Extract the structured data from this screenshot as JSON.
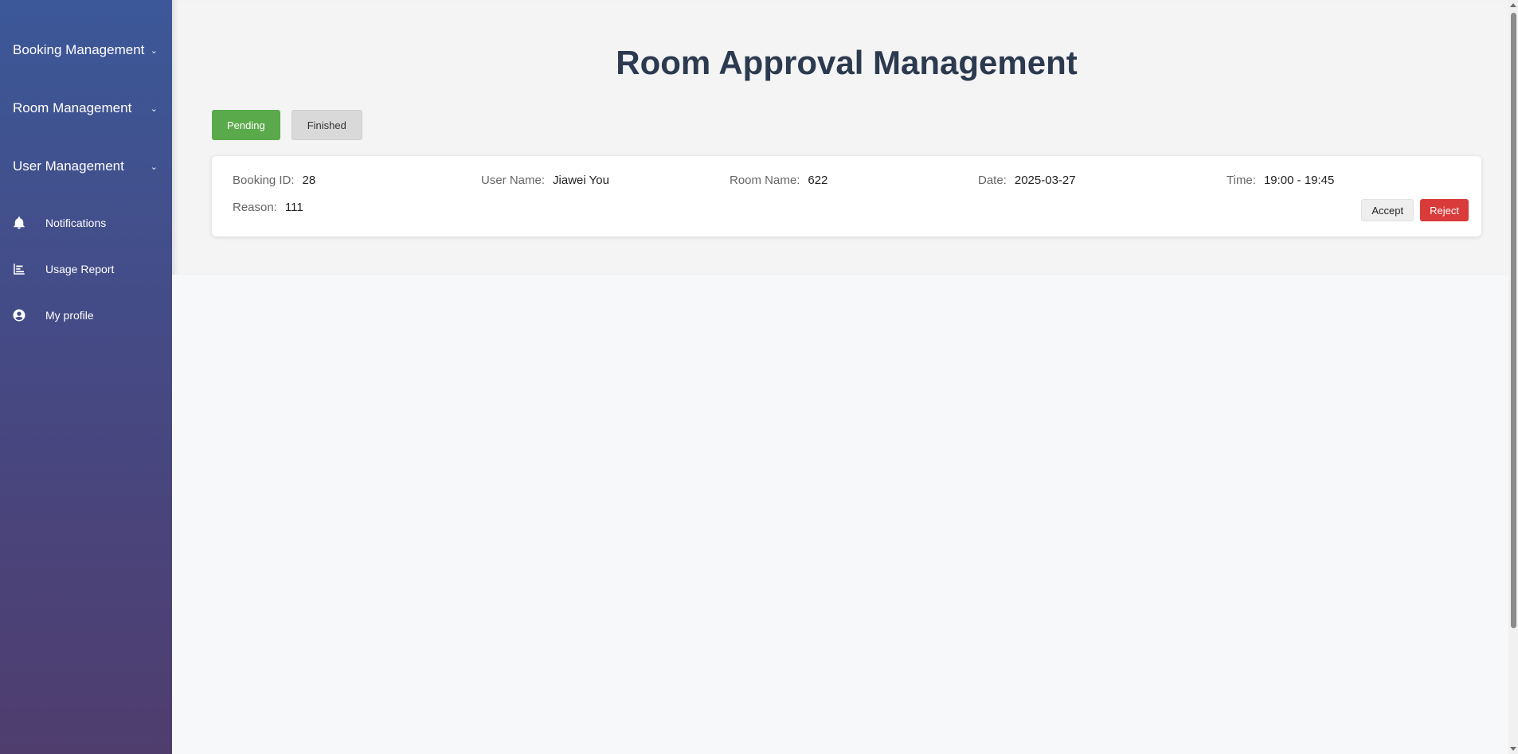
{
  "sidebar": {
    "groups": [
      {
        "label": "Booking Management",
        "icon": "chevron-down-icon"
      },
      {
        "label": "Room Management",
        "icon": "chevron-down-icon"
      },
      {
        "label": "User Management",
        "icon": "chevron-down-icon"
      }
    ],
    "items": [
      {
        "label": "Notifications",
        "icon": "bell-icon"
      },
      {
        "label": "Usage Report",
        "icon": "bar-chart-icon"
      },
      {
        "label": "My profile",
        "icon": "user-circle-icon"
      }
    ]
  },
  "main": {
    "title": "Room Approval Management",
    "tabs": [
      {
        "label": "Pending",
        "active": true
      },
      {
        "label": "Finished",
        "active": false
      }
    ],
    "booking": {
      "booking_id_label": "Booking ID:",
      "booking_id": "28",
      "user_name_label": "User Name:",
      "user_name": "Jiawei You",
      "room_name_label": "Room Name:",
      "room_name": "622",
      "date_label": "Date:",
      "date": "2025-03-27",
      "time_label": "Time:",
      "time": "19:00 - 19:45",
      "reason_label": "Reason:",
      "reason": "111",
      "accept_label": "Accept",
      "reject_label": "Reject"
    }
  },
  "colors": {
    "sidebar_top": "#3c5898",
    "sidebar_bottom": "#4f3d6e",
    "pending_tab": "#5aaa4b",
    "reject_button": "#d93a3a",
    "title": "#2c3a4f"
  }
}
